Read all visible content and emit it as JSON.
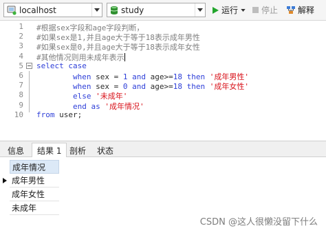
{
  "toolbar": {
    "connection": "localhost",
    "database": "study",
    "run_label": "运行",
    "stop_label": "停止",
    "explain_label": "解释"
  },
  "editor": {
    "lines": [
      {
        "num": "1",
        "tokens": [
          {
            "t": "#根据sex字段和age字段判断，",
            "c": "cmt"
          }
        ]
      },
      {
        "num": "2",
        "tokens": [
          {
            "t": "#如果sex是1,并且age大于等于18表示成年男性",
            "c": "cmt"
          }
        ]
      },
      {
        "num": "3",
        "tokens": [
          {
            "t": "#如果sex是0,并且age大于等于18表示成年女性",
            "c": "cmt"
          }
        ]
      },
      {
        "num": "4",
        "tokens": [
          {
            "t": "#其他情况则用未成年表示",
            "c": "cmt"
          }
        ]
      },
      {
        "num": "5",
        "tokens": [
          {
            "t": "select case",
            "c": "kw"
          }
        ]
      },
      {
        "num": "6",
        "tokens": [
          {
            "t": "        ",
            "c": "pl"
          },
          {
            "t": "when",
            "c": "kw"
          },
          {
            "t": " sex = ",
            "c": "pl"
          },
          {
            "t": "1",
            "c": "num"
          },
          {
            "t": " ",
            "c": "pl"
          },
          {
            "t": "and",
            "c": "kw"
          },
          {
            "t": " age>=",
            "c": "pl"
          },
          {
            "t": "18",
            "c": "num"
          },
          {
            "t": " ",
            "c": "pl"
          },
          {
            "t": "then",
            "c": "kw"
          },
          {
            "t": " ",
            "c": "pl"
          },
          {
            "t": "'成年男性'",
            "c": "str"
          }
        ]
      },
      {
        "num": "7",
        "tokens": [
          {
            "t": "        ",
            "c": "pl"
          },
          {
            "t": "when",
            "c": "kw"
          },
          {
            "t": " sex = ",
            "c": "pl"
          },
          {
            "t": "0",
            "c": "num"
          },
          {
            "t": " ",
            "c": "pl"
          },
          {
            "t": "and",
            "c": "kw"
          },
          {
            "t": " age>=",
            "c": "pl"
          },
          {
            "t": "18",
            "c": "num"
          },
          {
            "t": " ",
            "c": "pl"
          },
          {
            "t": "then",
            "c": "kw"
          },
          {
            "t": " ",
            "c": "pl"
          },
          {
            "t": "'成年女性'",
            "c": "str"
          }
        ]
      },
      {
        "num": "8",
        "tokens": [
          {
            "t": "        ",
            "c": "pl"
          },
          {
            "t": "else",
            "c": "kw"
          },
          {
            "t": " ",
            "c": "pl"
          },
          {
            "t": "'未成年'",
            "c": "str"
          }
        ]
      },
      {
        "num": "9",
        "tokens": [
          {
            "t": "        ",
            "c": "pl"
          },
          {
            "t": "end",
            "c": "kw"
          },
          {
            "t": " ",
            "c": "pl"
          },
          {
            "t": "as",
            "c": "kw"
          },
          {
            "t": " ",
            "c": "pl"
          },
          {
            "t": "'成年情况'",
            "c": "str"
          }
        ]
      },
      {
        "num": "10",
        "tokens": [
          {
            "t": "from",
            "c": "kw"
          },
          {
            "t": " user;",
            "c": "pl"
          }
        ]
      }
    ]
  },
  "tabs": [
    "信息",
    "结果 1",
    "剖析",
    "状态"
  ],
  "result": {
    "column": "成年情况",
    "rows": [
      "成年男性",
      "成年女性",
      "未成年"
    ]
  },
  "watermark": "CSDN @这人很懒没留下什么",
  "icons": {
    "connection": "db-connection-icon",
    "database": "database-icon",
    "run": "play-icon",
    "stop": "stop-icon",
    "explain": "explain-icon"
  },
  "colors": {
    "keyword": "#2e3fd8",
    "string": "#d8121a",
    "comment": "#7f7f7f",
    "run_green": "#22a52c",
    "header_blue": "#dce9f7"
  }
}
